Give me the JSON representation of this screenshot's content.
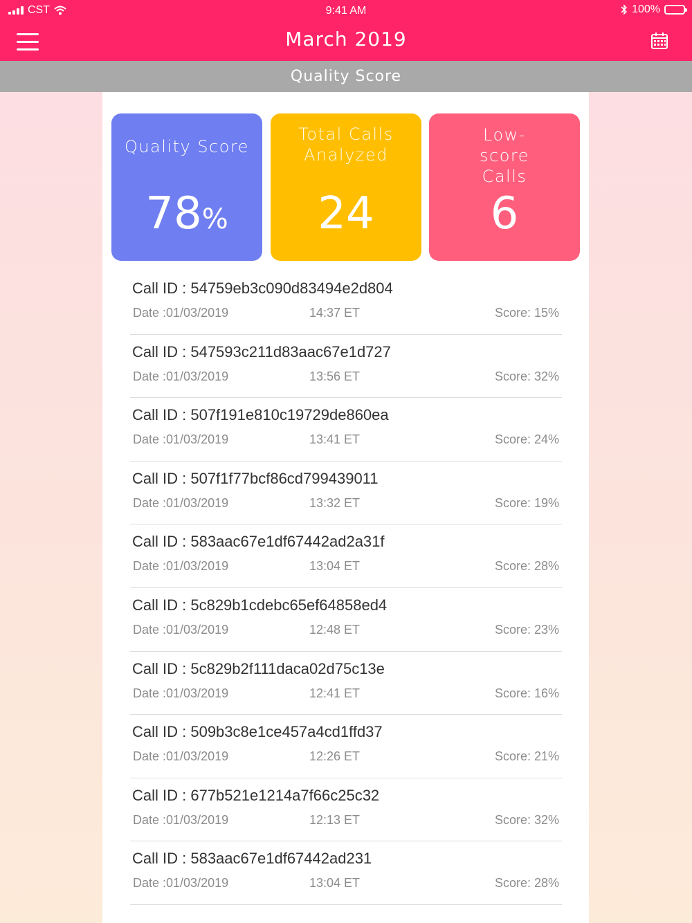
{
  "status_bar": {
    "carrier": "CST",
    "time": "9:41 AM",
    "battery": "100%"
  },
  "header": {
    "title": "March 2019",
    "menu_icon": "hamburger-menu-icon",
    "calendar_icon": "calendar-icon",
    "background": "#ff2467"
  },
  "subheader": {
    "title": "Quality Score"
  },
  "cards": [
    {
      "label": "Quality Score",
      "value": "78",
      "unit": "%",
      "color": "#6f7ef0"
    },
    {
      "label": "Total Calls Analyzed",
      "value": "24",
      "color": "#ffbf00"
    },
    {
      "label": "Low-score Calls",
      "value": "6",
      "color": "#ff5f7d"
    }
  ],
  "calls": [
    {
      "id": "Call ID : 54759eb3c090d83494e2d804",
      "date": "Date :01/03/2019",
      "time": "14:37 ET",
      "score": "Score: 15%"
    },
    {
      "id": "Call ID : 547593c211d83aac67e1d727",
      "date": "Date :01/03/2019",
      "time": "13:56 ET",
      "score": "Score: 32%"
    },
    {
      "id": "Call ID : 507f191e810c19729de860ea",
      "date": "Date :01/03/2019",
      "time": "13:41 ET",
      "score": "Score: 24%"
    },
    {
      "id": "Call ID : 507f1f77bcf86cd799439011",
      "date": "Date :01/03/2019",
      "time": "13:32 ET",
      "score": "Score: 19%"
    },
    {
      "id": "Call ID : 583aac67e1df67442ad2a31f",
      "date": "Date :01/03/2019",
      "time": "13:04 ET",
      "score": "Score: 28%"
    },
    {
      "id": "Call ID : 5c829b1cdebc65ef64858ed4",
      "date": "Date :01/03/2019",
      "time": "12:48 ET",
      "score": "Score: 23%"
    },
    {
      "id": "Call ID : 5c829b2f111daca02d75c13e",
      "date": "Date :01/03/2019",
      "time": "12:41 ET",
      "score": "Score: 16%"
    },
    {
      "id": "Call ID : 509b3c8e1ce457a4cd1ffd37",
      "date": "Date :01/03/2019",
      "time": "12:26 ET",
      "score": "Score: 21%"
    },
    {
      "id": "Call ID : 677b521e1214a7f66c25c32",
      "date": "Date :01/03/2019",
      "time": "12:13 ET",
      "score": "Score: 32%"
    },
    {
      "id": "Call ID : 583aac67e1df67442ad231",
      "date": "Date :01/03/2019",
      "time": "13:04 ET",
      "score": "Score: 28%"
    }
  ]
}
